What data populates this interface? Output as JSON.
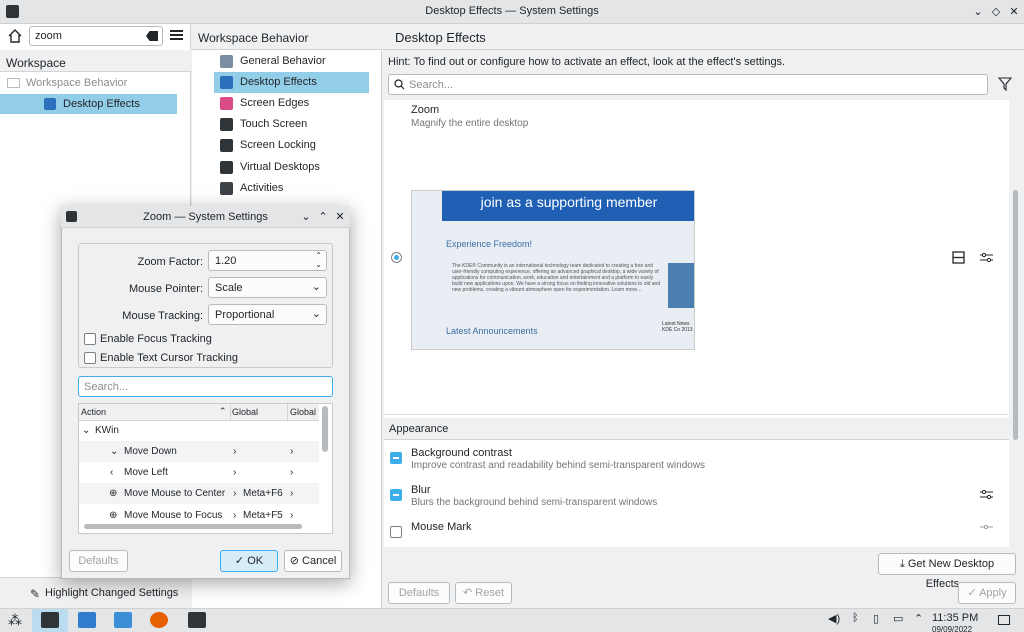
{
  "window": {
    "title": "Desktop Effects — System Settings"
  },
  "sidebar": {
    "search_value": "zoom",
    "section_title": "Workspace",
    "items": [
      {
        "label": "Workspace Behavior"
      },
      {
        "label": "Desktop Effects"
      }
    ],
    "highlight_label": "Highlight Changed Settings"
  },
  "middle": {
    "title": "Workspace Behavior",
    "items": [
      {
        "label": "General Behavior"
      },
      {
        "label": "Desktop Effects"
      },
      {
        "label": "Screen Edges"
      },
      {
        "label": "Touch Screen"
      },
      {
        "label": "Screen Locking"
      },
      {
        "label": "Virtual Desktops"
      },
      {
        "label": "Activities"
      }
    ]
  },
  "panel": {
    "title": "Desktop Effects",
    "hint": "Hint: To find out or configure how to activate an effect, look at the effect's settings.",
    "search_placeholder": "Search...",
    "zoom": {
      "name": "Zoom",
      "desc": "Magnify the entire desktop"
    },
    "preview": {
      "banner": "join  as a supporting member",
      "heading": "Experience Freedom!",
      "paragraph": "The KDE® Community is an international technology team dedicated to creating a free and user-friendly computing experience, offering an advanced graphical desktop, a wide variety of applications for communication, work, education and entertainment and a platform to easily build new applications upon. We have a strong focus on finding innovative solutions to old and new problems, creating a vibrant atmosphere open for experimentation. Learn more...",
      "announcements": "Latest Announcements",
      "news": "Latest News",
      "news_item": "KDE Co 2013"
    },
    "appearance_label": "Appearance",
    "effects": [
      {
        "name": "Background contrast",
        "desc": "Improve contrast and readability behind semi-transparent windows",
        "checked": true
      },
      {
        "name": "Blur",
        "desc": "Blurs the background behind semi-transparent windows",
        "checked": true
      },
      {
        "name": "Mouse Mark",
        "desc": "",
        "checked": false
      }
    ],
    "get_new_label": "Get New Desktop Effects...",
    "defaults_label": "Defaults",
    "reset_label": "Reset",
    "apply_label": "Apply"
  },
  "dialog": {
    "title": "Zoom — System Settings",
    "zoom_factor_label": "Zoom Factor:",
    "zoom_factor_value": "1.20",
    "mouse_pointer_label": "Mouse Pointer:",
    "mouse_pointer_value": "Scale",
    "mouse_tracking_label": "Mouse Tracking:",
    "mouse_tracking_value": "Proportional",
    "focus_tracking_label": "Enable Focus Tracking",
    "text_cursor_label": "Enable Text Cursor Tracking",
    "search_placeholder": "Search...",
    "columns": [
      "Action",
      "Global",
      "Global A"
    ],
    "group": "KWin",
    "rows": [
      {
        "action": "Move Down",
        "global": "",
        "alt": ""
      },
      {
        "action": "Move Left",
        "global": "",
        "alt": ""
      },
      {
        "action": "Move Mouse to Center",
        "global": "Meta+F6",
        "alt": ""
      },
      {
        "action": "Move Mouse to Focus",
        "global": "Meta+F5",
        "alt": ""
      }
    ],
    "defaults_label": "Defaults",
    "ok_label": "OK",
    "cancel_label": "Cancel"
  },
  "taskbar": {
    "time": "11:35 PM",
    "date": "09/09/2022"
  },
  "colors": {
    "accent": "#3daee9",
    "selection": "#93cee9"
  }
}
